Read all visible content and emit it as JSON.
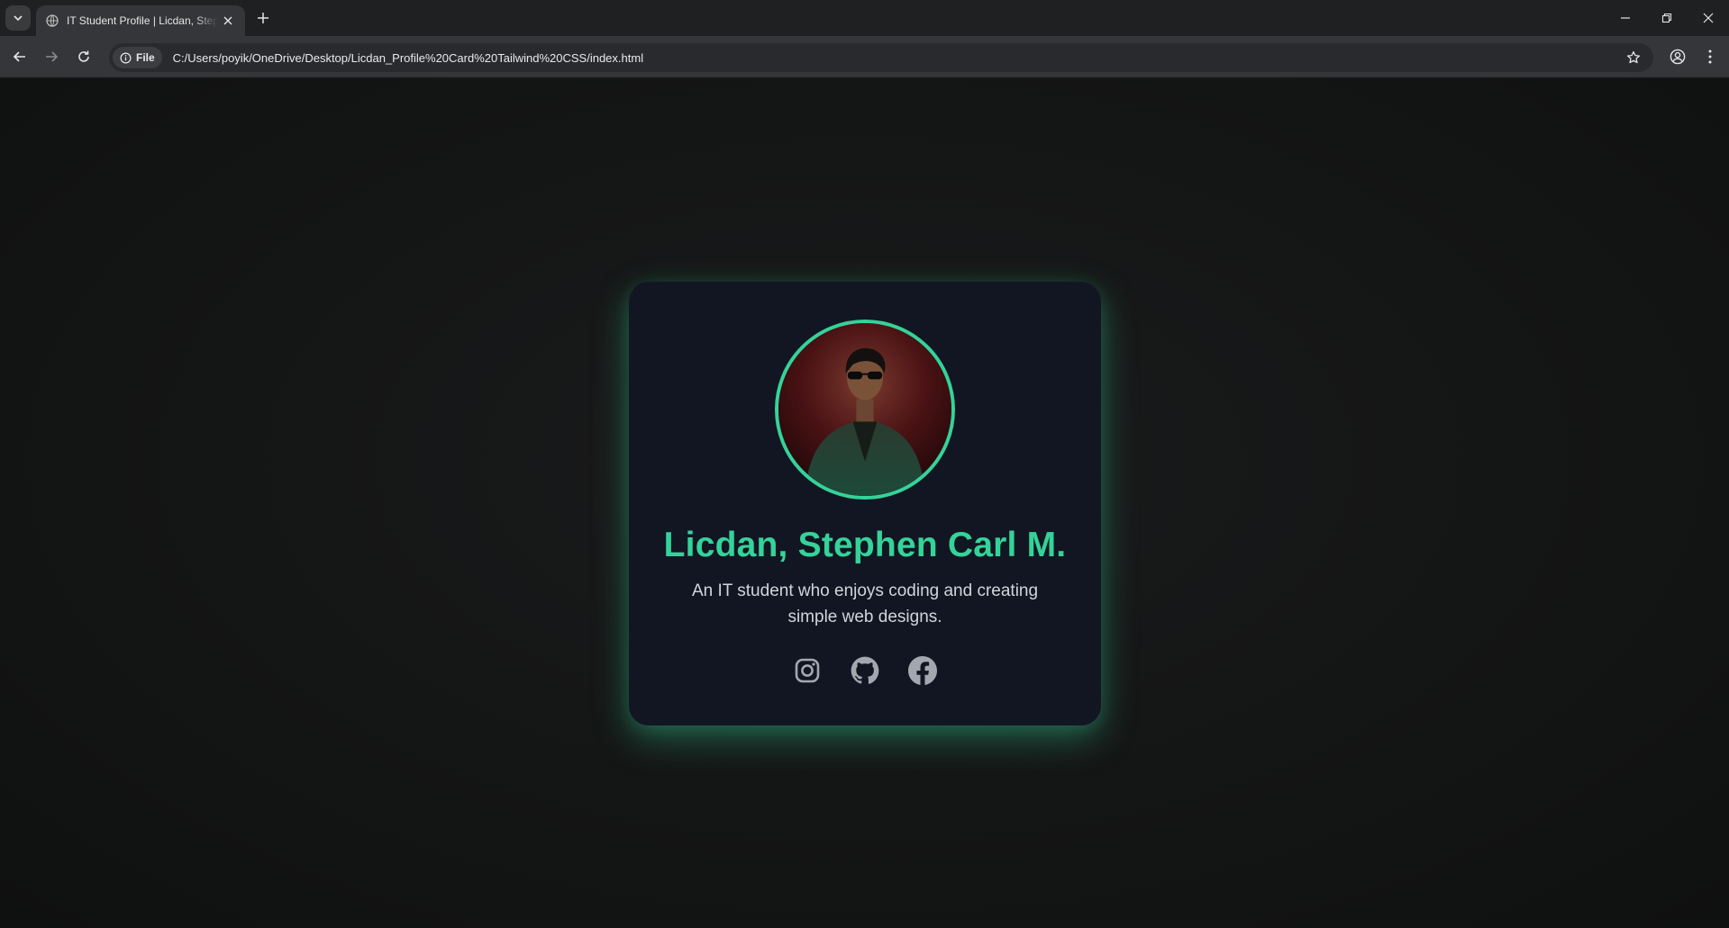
{
  "browser": {
    "tab_title": "IT Student Profile | Licdan, Stephen Carl M.",
    "address_chip": "File",
    "url": "C:/Users/poyik/OneDrive/Desktop/Licdan_Profile%20Card%20Tailwind%20CSS/index.html"
  },
  "profile": {
    "name": "Licdan, Stephen Carl M.",
    "bio": "An IT student who enjoys coding and creating simple web designs.",
    "avatar_icon": "profile-photo",
    "socials": [
      {
        "icon": "instagram-icon"
      },
      {
        "icon": "github-icon"
      },
      {
        "icon": "facebook-icon"
      }
    ]
  },
  "colors": {
    "accent": "#34d399",
    "card_bg": "#121622",
    "page_bg": "#141515",
    "bio_text": "#d1d5db",
    "icon": "#9ca3af"
  }
}
